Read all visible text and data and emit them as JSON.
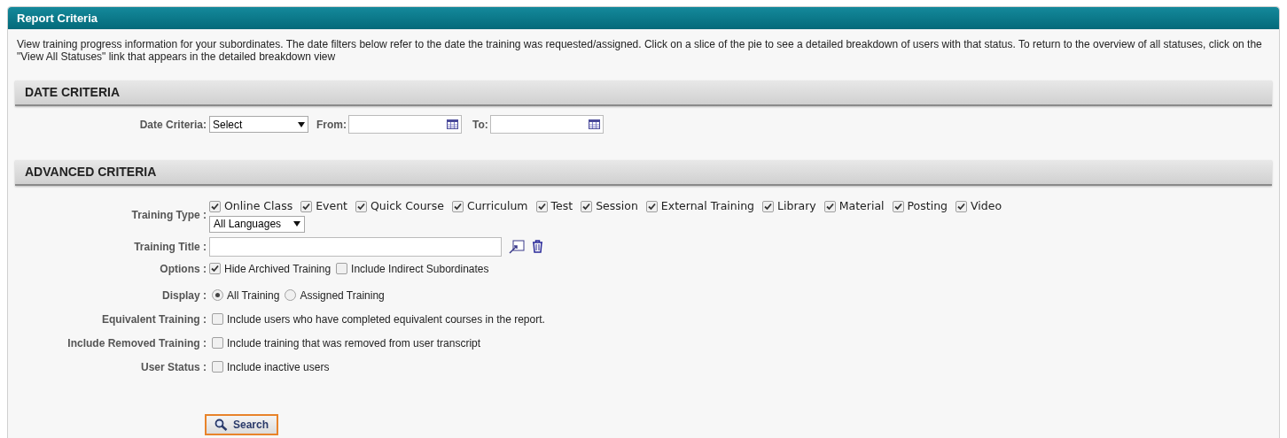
{
  "panel": {
    "title": "Report Criteria",
    "description": "View training progress information for your subordinates. The date filters below refer to the date the training was requested/assigned. Click on a slice of the pie to see a detailed breakdown of users with that status. To return to the overview of all statuses, click on the \"View All Statuses\" link that appears in the detailed breakdown view"
  },
  "date_criteria": {
    "heading": "DATE CRITERIA",
    "criteria_label": "Date Criteria:",
    "criteria_value": "Select",
    "from_label": "From:",
    "to_label": "To:"
  },
  "advanced_criteria": {
    "heading": "ADVANCED CRITERIA",
    "training_type": {
      "label": "Training Type :",
      "types": [
        {
          "label": "Online Class",
          "checked": true
        },
        {
          "label": "Event",
          "checked": true
        },
        {
          "label": "Quick Course",
          "checked": true
        },
        {
          "label": "Curriculum",
          "checked": true
        },
        {
          "label": "Test",
          "checked": true
        },
        {
          "label": "Session",
          "checked": true
        },
        {
          "label": "External Training",
          "checked": true
        },
        {
          "label": "Library",
          "checked": true
        },
        {
          "label": "Material",
          "checked": true
        },
        {
          "label": "Posting",
          "checked": true
        },
        {
          "label": "Video",
          "checked": true
        }
      ],
      "language": "All Languages"
    },
    "training_title": {
      "label": "Training Title :"
    },
    "options": {
      "label": "Options :",
      "items": [
        {
          "label": "Hide Archived Training",
          "checked": true
        },
        {
          "label": "Include Indirect Subordinates",
          "checked": false
        }
      ]
    },
    "display": {
      "label": "Display :",
      "items": [
        {
          "label": "All Training",
          "selected": true
        },
        {
          "label": "Assigned Training",
          "selected": false
        }
      ]
    },
    "checkbox_rows": [
      {
        "label": "Equivalent Training :",
        "text": "Include users who have completed equivalent courses in the report.",
        "checked": false
      },
      {
        "label": "Include Removed Training :",
        "text": "Include training that was removed from user transcript",
        "checked": false
      },
      {
        "label": "User Status :",
        "text": "Include inactive users",
        "checked": false
      }
    ]
  },
  "search_button": "Search"
}
